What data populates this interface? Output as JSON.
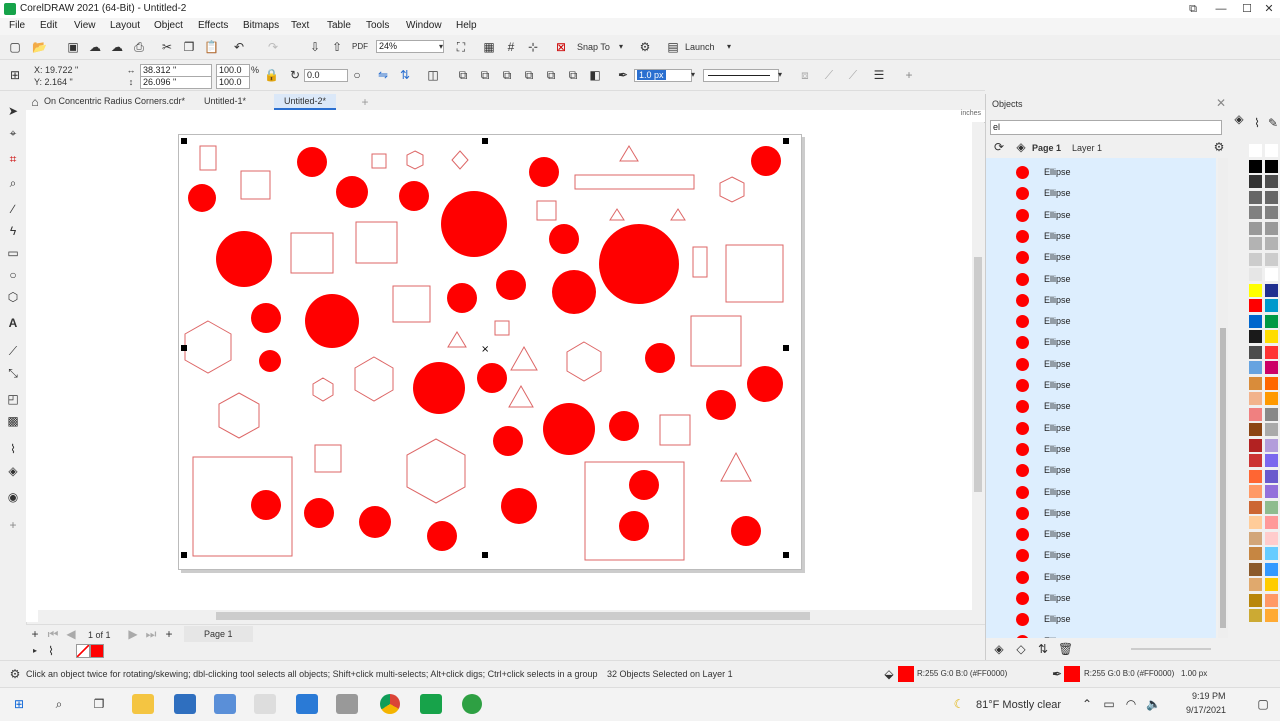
{
  "title": "CorelDRAW 2021 (64-Bit) - Untitled-2",
  "menu": [
    "File",
    "Edit",
    "View",
    "Layout",
    "Object",
    "Effects",
    "Bitmaps",
    "Text",
    "Table",
    "Tools",
    "Window",
    "Help"
  ],
  "standard_toolbar": {
    "zoom": "24%",
    "snap_to": "Snap To",
    "launch": "Launch"
  },
  "property_bar": {
    "x": "X: 19.722 \"",
    "y": "Y: 2.164 \"",
    "width": "38.312 \"",
    "height": "26.096 \"",
    "scale_w": "100.0",
    "scale_h": "100.0",
    "percent": "%",
    "angle": "0.0",
    "outline_width": "1.0 px"
  },
  "doc_tabs": [
    "On Concentric Radius Corners.cdr*",
    "Untitled-1*",
    "Untitled-2*"
  ],
  "active_tab": 2,
  "ruler_unit": "inches",
  "page_nav": {
    "counter": "1 of 1",
    "page_tab": "Page 1"
  },
  "status": {
    "hint": "Click an object twice for rotating/skewing; dbl-clicking tool selects all objects; Shift+click multi-selects; Alt+click digs; Ctrl+click selects in a group",
    "selection": "32 Objects Selected on Layer 1",
    "fill_color": "R:255 G:0 B:0 (#FF0000)",
    "outline_color": "R:255 G:0 B:0 (#FF0000)",
    "outline_width": "1.00 px"
  },
  "objects_docker": {
    "title": "Objects",
    "search": "el",
    "page": "Page 1",
    "layer": "Layer 1",
    "item_label": "Ellipse",
    "item_count": 23
  },
  "taskbar": {
    "weather": "81°F  Mostly clear",
    "time": "9:19 PM",
    "date": "9/17/2021"
  },
  "colors": {
    "accent_red": "#FF0000",
    "outline": "#d66",
    "selection_bg": "#ddeefe"
  }
}
